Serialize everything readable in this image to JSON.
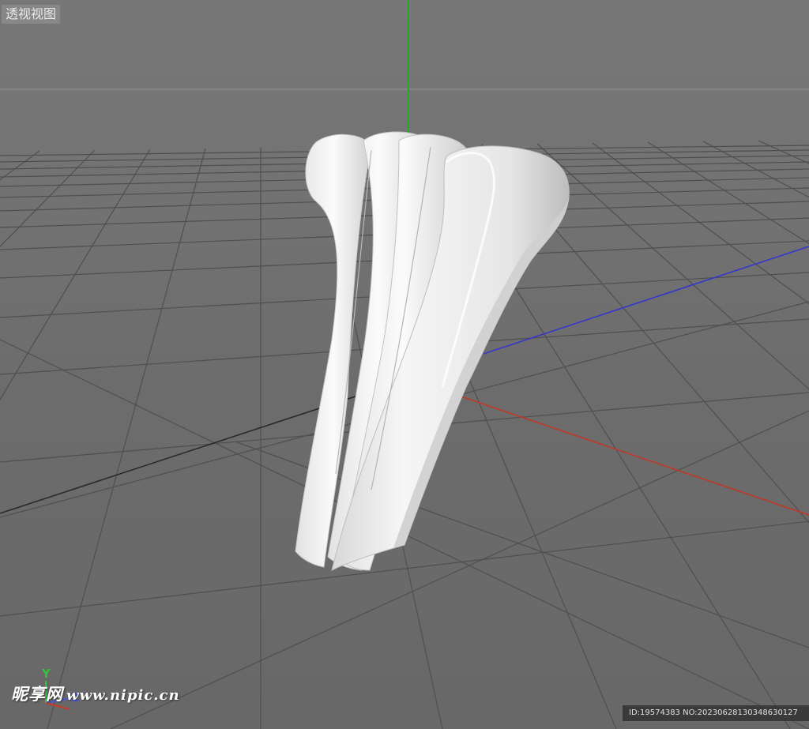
{
  "viewport": {
    "label": "透视视图"
  },
  "axis_gizmo": {
    "y_label": "Y",
    "z_label": "Z"
  },
  "watermark": {
    "brand": "昵享网",
    "site": "www.nipic.cn"
  },
  "image_id": "ID:19574383 NO:20230628130348630127",
  "colors": {
    "y_axis": "#1fb21f",
    "x_axis": "#c43a2a",
    "z_axis": "#3a3ad6",
    "grid": "#4e4e4e",
    "object": "#f0f0f0"
  }
}
